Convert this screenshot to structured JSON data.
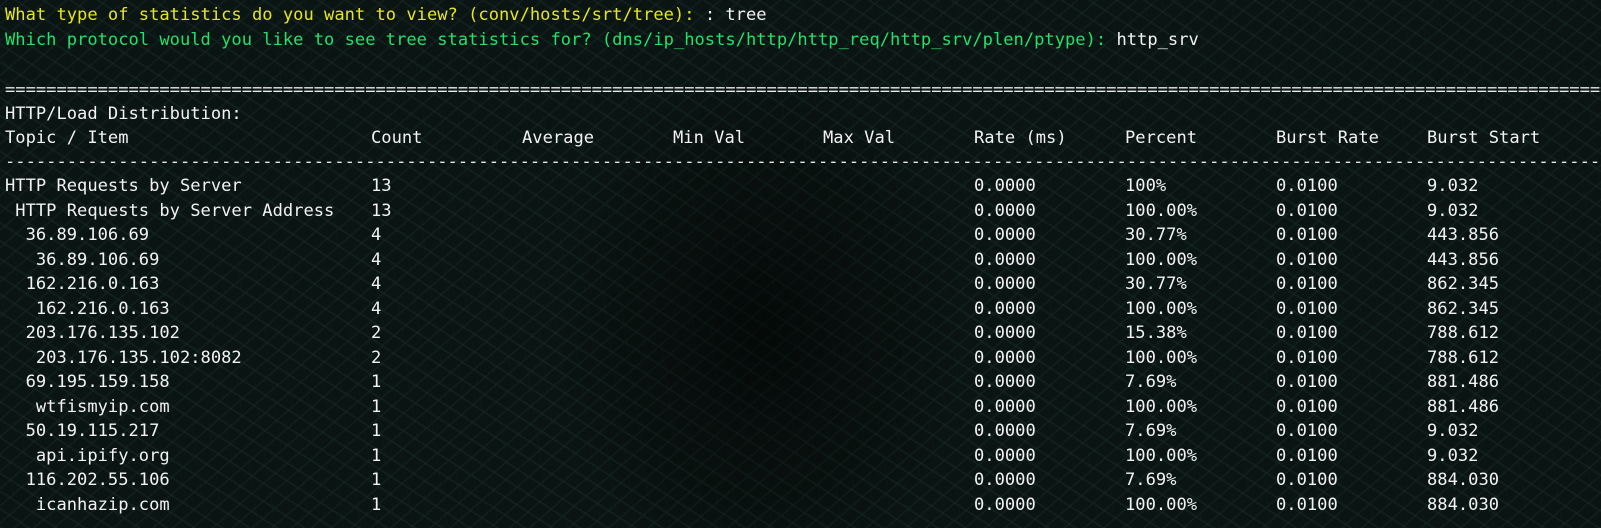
{
  "prompt1": {
    "question": "What type of statistics do you want to view? (conv/hosts/srt/tree): ",
    "answer": ": tree"
  },
  "prompt2": {
    "question": "Which protocol would you like to see tree statistics for? (dns/ip_hosts/http/http_req/http_srv/plen/ptype): ",
    "answer": "http_srv"
  },
  "report": {
    "separator_char": "=",
    "dash_char": "-",
    "title": "HTTP/Load Distribution:",
    "columns": [
      "Topic / Item",
      "Count",
      "Average",
      "Min Val",
      "Max Val",
      "Rate (ms)",
      "Percent",
      "Burst Rate",
      "Burst Start"
    ],
    "rows": [
      {
        "topic": "HTTP Requests by Server",
        "count": "13",
        "average": "",
        "min": "",
        "max": "",
        "rate": "0.0000",
        "percent": "100%",
        "burst_rate": "0.0100",
        "burst_start": "9.032"
      },
      {
        "topic": " HTTP Requests by Server Address",
        "count": "13",
        "average": "",
        "min": "",
        "max": "",
        "rate": "0.0000",
        "percent": "100.00%",
        "burst_rate": "0.0100",
        "burst_start": "9.032"
      },
      {
        "topic": "  36.89.106.69",
        "count": "4",
        "average": "",
        "min": "",
        "max": "",
        "rate": "0.0000",
        "percent": "30.77%",
        "burst_rate": "0.0100",
        "burst_start": "443.856"
      },
      {
        "topic": "   36.89.106.69",
        "count": "4",
        "average": "",
        "min": "",
        "max": "",
        "rate": "0.0000",
        "percent": "100.00%",
        "burst_rate": "0.0100",
        "burst_start": "443.856"
      },
      {
        "topic": "  162.216.0.163",
        "count": "4",
        "average": "",
        "min": "",
        "max": "",
        "rate": "0.0000",
        "percent": "30.77%",
        "burst_rate": "0.0100",
        "burst_start": "862.345"
      },
      {
        "topic": "   162.216.0.163",
        "count": "4",
        "average": "",
        "min": "",
        "max": "",
        "rate": "0.0000",
        "percent": "100.00%",
        "burst_rate": "0.0100",
        "burst_start": "862.345"
      },
      {
        "topic": "  203.176.135.102",
        "count": "2",
        "average": "",
        "min": "",
        "max": "",
        "rate": "0.0000",
        "percent": "15.38%",
        "burst_rate": "0.0100",
        "burst_start": "788.612"
      },
      {
        "topic": "   203.176.135.102:8082",
        "count": "2",
        "average": "",
        "min": "",
        "max": "",
        "rate": "0.0000",
        "percent": "100.00%",
        "burst_rate": "0.0100",
        "burst_start": "788.612"
      },
      {
        "topic": "  69.195.159.158",
        "count": "1",
        "average": "",
        "min": "",
        "max": "",
        "rate": "0.0000",
        "percent": "7.69%",
        "burst_rate": "0.0100",
        "burst_start": "881.486"
      },
      {
        "topic": "   wtfismyip.com",
        "count": "1",
        "average": "",
        "min": "",
        "max": "",
        "rate": "0.0000",
        "percent": "100.00%",
        "burst_rate": "0.0100",
        "burst_start": "881.486"
      },
      {
        "topic": "  50.19.115.217",
        "count": "1",
        "average": "",
        "min": "",
        "max": "",
        "rate": "0.0000",
        "percent": "7.69%",
        "burst_rate": "0.0100",
        "burst_start": "9.032"
      },
      {
        "topic": "   api.ipify.org",
        "count": "1",
        "average": "",
        "min": "",
        "max": "",
        "rate": "0.0000",
        "percent": "100.00%",
        "burst_rate": "0.0100",
        "burst_start": "9.032"
      },
      {
        "topic": "  116.202.55.106",
        "count": "1",
        "average": "",
        "min": "",
        "max": "",
        "rate": "0.0000",
        "percent": "7.69%",
        "burst_rate": "0.0100",
        "burst_start": "884.030"
      },
      {
        "topic": "   icanhazip.com",
        "count": "1",
        "average": "",
        "min": "",
        "max": "",
        "rate": "0.0000",
        "percent": "100.00%",
        "burst_rate": "0.0100",
        "burst_start": "884.030"
      }
    ]
  },
  "colors": {
    "prompt1": "#e6e61e",
    "prompt2": "#22e06a",
    "text": "#f2f2f2"
  }
}
